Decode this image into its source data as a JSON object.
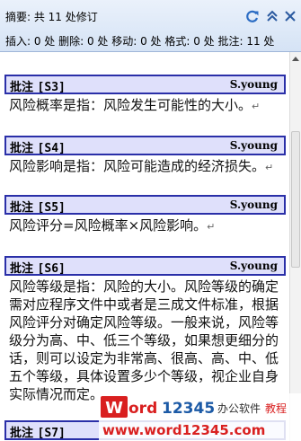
{
  "header": {
    "summary": "摘要: 共 11 处修订",
    "counts": "插入: 0 处  删除: 0 处  移动: 0 处  格式: 0 处  批注: 11 处"
  },
  "comments": [
    {
      "label": "批注",
      "ref": "[S3]",
      "author": "S.young",
      "text": "风险概率是指：风险发生可能性的大小。"
    },
    {
      "label": "批注",
      "ref": "[S4]",
      "author": "S.young",
      "text": "风险影响是指：风险可能造成的经济损失。"
    },
    {
      "label": "批注",
      "ref": "[S5]",
      "author": "S.young",
      "text": "风险评分=风险概率×风险影响。"
    },
    {
      "label": "批注",
      "ref": "[S6]",
      "author": "S.young",
      "text": "风险等级是指：风险的大小。风险等级的确定需对应程序文件中或者是三成文件标准，根据风险评分对确定风险等级。一般来说，风险等级分为高、中、低三个等级，如果想更细分的话，则可以设定为非常高、很高、高、中、低五个等级，具体设置多少个等级，视企业自身实际情况而定。"
    },
    {
      "label": "批注",
      "ref": "[S7]",
      "author": "",
      "text": ""
    }
  ],
  "paragraph_mark": "↵",
  "watermark": {
    "logo_text": "Word12345",
    "slogan": "办公软件教程",
    "url": "www.word12345.com"
  },
  "colors": {
    "comment_border": "#2a2fa8",
    "comment_fill": "#dfe0fb",
    "logo_red": "#d92020",
    "logo_blue": "#1c5aa6"
  }
}
